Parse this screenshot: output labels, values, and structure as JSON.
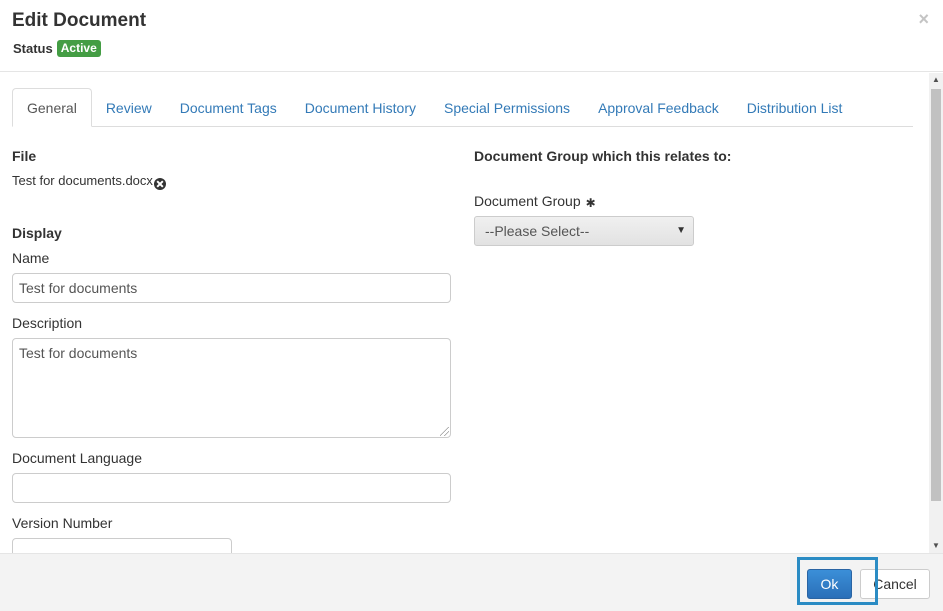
{
  "header": {
    "title": "Edit Document",
    "status_label": "Status",
    "status_badge": "Active",
    "close_symbol": "×"
  },
  "tabs": [
    {
      "label": "General",
      "active": true
    },
    {
      "label": "Review",
      "active": false
    },
    {
      "label": "Document Tags",
      "active": false
    },
    {
      "label": "Document History",
      "active": false
    },
    {
      "label": "Special Permissions",
      "active": false
    },
    {
      "label": "Approval Feedback",
      "active": false
    },
    {
      "label": "Distribution List",
      "active": false
    }
  ],
  "left": {
    "file_heading": "File",
    "file_name": "Test for documents.docx",
    "display_heading": "Display",
    "name_label": "Name",
    "name_value": "Test for documents",
    "description_label": "Description",
    "description_value": "Test for documents",
    "language_label": "Document Language",
    "language_value": "",
    "version_label": "Version Number",
    "version_value": ""
  },
  "right": {
    "group_heading": "Document Group which this relates to:",
    "group_label": "Document Group",
    "required_symbol": "✱",
    "group_select_value": "--Please Select--"
  },
  "footer": {
    "ok_label": "Ok",
    "cancel_label": "Cancel"
  },
  "colors": {
    "badge": "#449d44",
    "link": "#337ab7",
    "primary_button": "#2f7ec9",
    "highlight": "#2b8cc4"
  }
}
